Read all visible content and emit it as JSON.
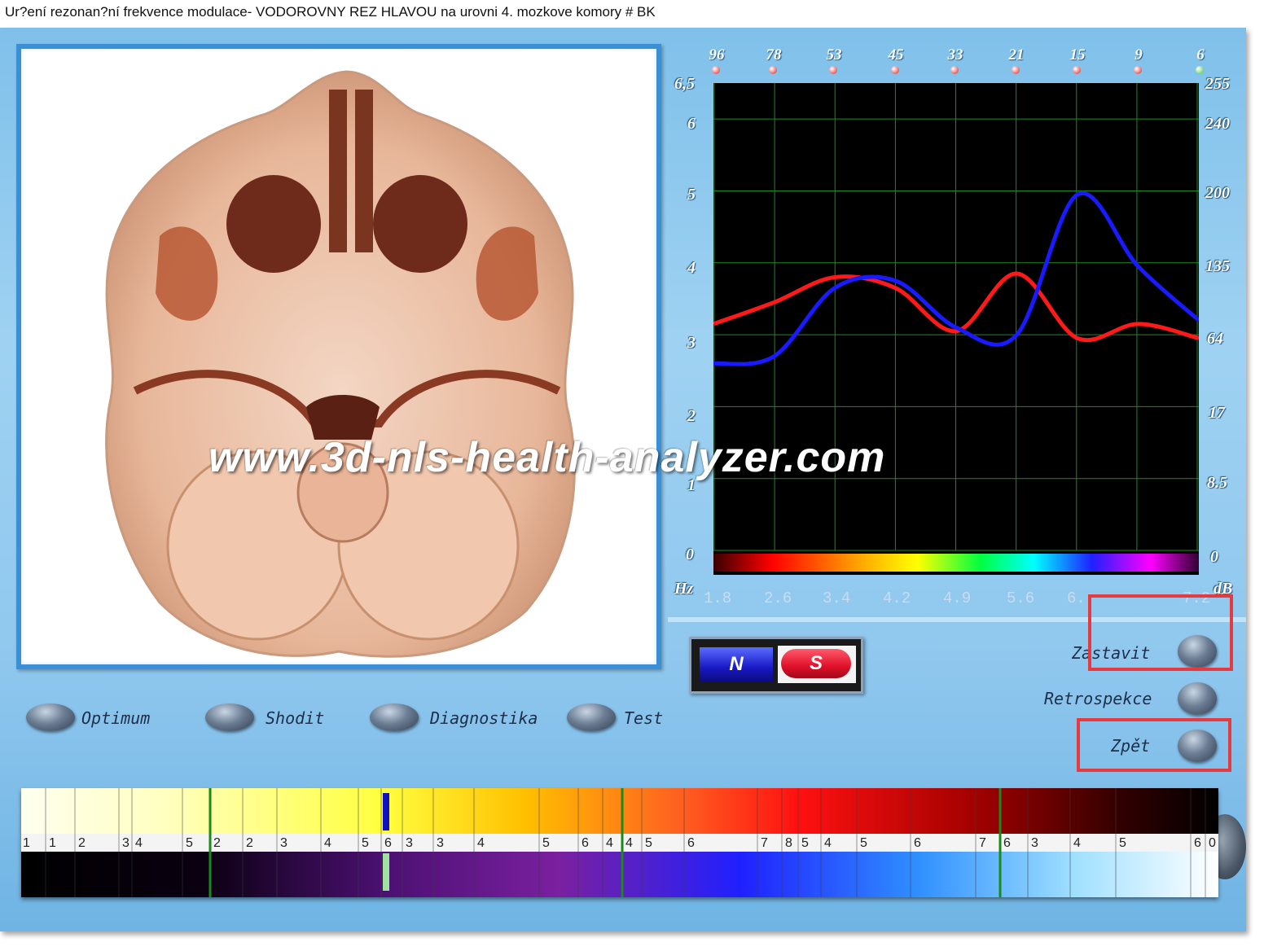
{
  "window": {
    "title": "Ur?ení rezonan?ní frekvence modulace- VODOROVNY REZ HLAVOU na urovni 4. mozkove komory # BK"
  },
  "image_panel": {
    "watermark": "www.3d-nls-health-analyzer.com"
  },
  "chart": {
    "top_labels": [
      "96",
      "78",
      "53",
      "45",
      "33",
      "21",
      "15",
      "9",
      "6"
    ],
    "top_dot_colors": [
      "#e21b1b",
      "#e21b1b",
      "#e21b1b",
      "#e21b1b",
      "#e21b1b",
      "#e21b1b",
      "#e21b1b",
      "#e21b1b",
      "#37c837"
    ],
    "left_axis": [
      "6,5",
      "6",
      "5",
      "4",
      "3",
      "2",
      "1",
      "0"
    ],
    "right_axis": [
      "255",
      "240",
      "200",
      "135",
      "64",
      "17",
      "8.5",
      "0"
    ],
    "x_unit": "Hz",
    "y_unit_right": "dB",
    "x_labels": [
      "1.8",
      "2.6",
      "3.4",
      "4.2",
      "4.9",
      "5.6",
      "6.",
      "",
      "7.2"
    ]
  },
  "chart_data": {
    "type": "line",
    "x": [
      "1.8",
      "2.6",
      "3.4",
      "4.2",
      "4.9",
      "5.6",
      "6.",
      "",
      "7.2"
    ],
    "y_left_ticks": [
      "0",
      "1",
      "2",
      "3",
      "4",
      "5",
      "6",
      "6,5"
    ],
    "y_right_ticks": [
      "0",
      "8.5",
      "17",
      "64",
      "135",
      "200",
      "240",
      "255"
    ],
    "ylim": [
      0,
      6.5
    ],
    "grid": true,
    "series": [
      {
        "color": "#ff1a1a",
        "values": [
          3.15,
          3.45,
          3.8,
          3.65,
          3.05,
          3.85,
          2.95,
          3.15,
          2.95
        ]
      },
      {
        "color": "#1a1aff",
        "values": [
          2.6,
          2.7,
          3.65,
          3.75,
          3.1,
          3.0,
          4.95,
          3.95,
          3.2
        ]
      }
    ]
  },
  "buttons": {
    "optimum": "Optimum",
    "shodit": "Shodit",
    "diagnostika": "Diagnostika",
    "test": "Test",
    "zastavit": "Zastavit",
    "retrospekce": "Retrospekce",
    "zpet": "Zpět",
    "n": "N",
    "s": "S"
  },
  "scale": {
    "numbers": [
      "1",
      "1",
      "2",
      "3",
      "4",
      "5",
      "2",
      "2",
      "3",
      "4",
      "5",
      "6",
      "3",
      "3",
      "4",
      "5",
      "6",
      "4",
      "4",
      "5",
      "6",
      "7",
      "8",
      "5",
      "4",
      "5",
      "6",
      "7",
      "6",
      "3",
      "4",
      "5",
      "6",
      "0"
    ]
  }
}
